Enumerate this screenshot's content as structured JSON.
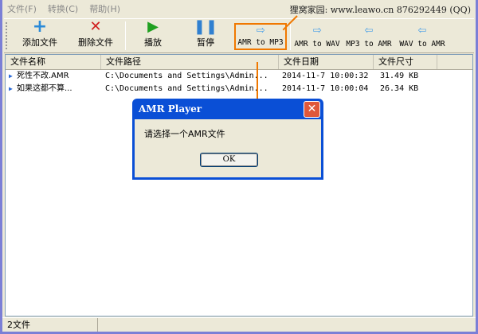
{
  "menu": [
    "文件(F)",
    "转换(C)",
    "帮助(H)"
  ],
  "site_text": "狸窝家园: www.leawo.cn 876292449 (QQ)",
  "toolbar": [
    {
      "label": "添加文件",
      "icon": "plus-icon",
      "color": "#2a8ad8"
    },
    {
      "label": "删除文件",
      "icon": "x-icon",
      "color": "#d02020"
    },
    {
      "label": "播放",
      "icon": "play-icon",
      "color": "#20a020"
    },
    {
      "label": "暂停",
      "icon": "pause-icon",
      "color": "#3080d0"
    },
    {
      "label": "AMR to MP3",
      "icon": "arrow-right-icon",
      "highlighted": true
    },
    {
      "label": "AMR to WAV",
      "icon": "arrow-right-icon"
    },
    {
      "label": "MP3 to AMR",
      "icon": "arrow-left-icon"
    },
    {
      "label": "WAV to AMR",
      "icon": "arrow-left-icon"
    }
  ],
  "columns": [
    "文件名称",
    "文件路径",
    "文件日期",
    "文件尺寸"
  ],
  "rows": [
    {
      "name": "死性不改.AMR",
      "path": "C:\\Documents and Settings\\Admin...",
      "date": "2014-11-7 10:00:32",
      "size": "31.49 KB"
    },
    {
      "name": "如果这都不算...",
      "path": "C:\\Documents and Settings\\Admin...",
      "date": "2014-11-7 10:00:04",
      "size": "26.34 KB"
    }
  ],
  "dialog": {
    "title": "AMR Player",
    "message": "请选择一个AMR文件",
    "ok": "OK"
  },
  "status": "2文件",
  "highlight_color": "#f07800"
}
